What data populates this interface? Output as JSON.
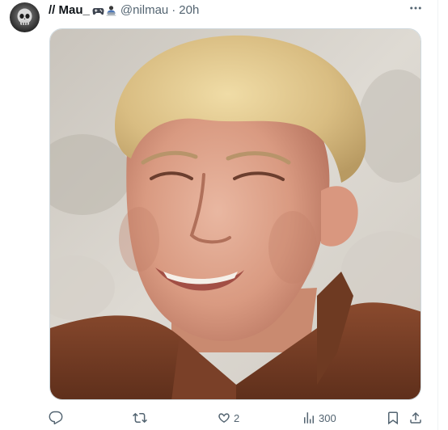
{
  "tweet": {
    "author": {
      "display_name": "// Mau_",
      "handle": "@nilmau",
      "badge_icons": [
        "game-controller-icon",
        "laptop-person-icon"
      ]
    },
    "separator": "·",
    "time": "20h",
    "media": {
      "icon": "photo"
    },
    "actions": {
      "reply_count": "",
      "retweet_count": "",
      "like_count": "2",
      "views_count": "300"
    },
    "icons": {
      "more": "more-icon",
      "reply": "reply-icon",
      "retweet": "retweet-icon",
      "like": "heart-icon",
      "views": "views-icon",
      "bookmark": "bookmark-icon",
      "share": "share-icon"
    },
    "colors": {
      "secondary_text": "#536471",
      "primary_text": "#0f1419",
      "border": "#cfd9de"
    }
  }
}
